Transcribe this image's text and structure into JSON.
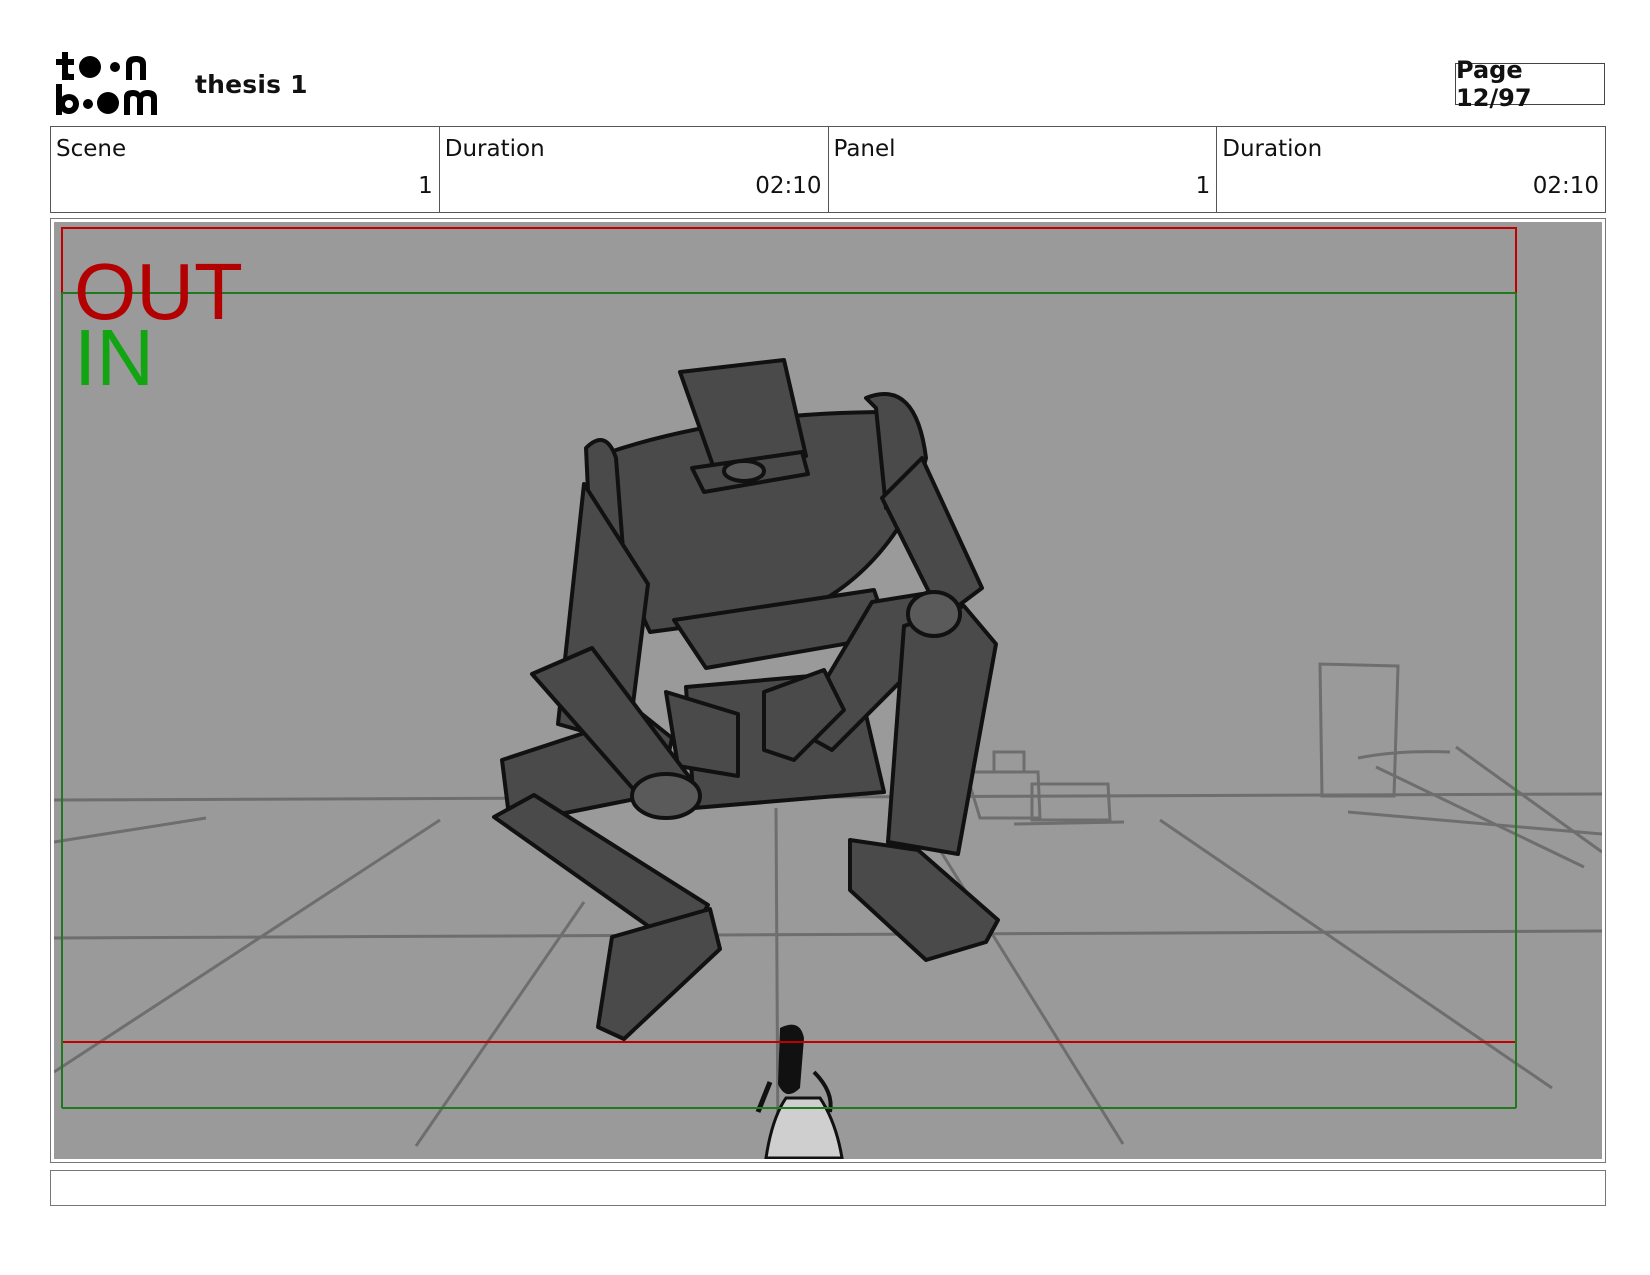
{
  "header": {
    "project_title": "thesis 1",
    "page_label": "Page 12/97"
  },
  "info": {
    "scene_label": "Scene",
    "scene_value": "1",
    "scene_duration_label": "Duration",
    "scene_duration_value": "02:10",
    "panel_label": "Panel",
    "panel_value": "1",
    "panel_duration_label": "Duration",
    "panel_duration_value": "02:10"
  },
  "panel": {
    "out_label": "OUT",
    "in_label": "IN",
    "colors": {
      "background": "#9a9a9a",
      "out_frame": "#c00000",
      "in_frame": "#1f7a1f",
      "out_text": "#b30000",
      "in_text": "#12a512",
      "robot_fill": "#4a4a4a"
    }
  },
  "notes": {
    "text": ""
  }
}
